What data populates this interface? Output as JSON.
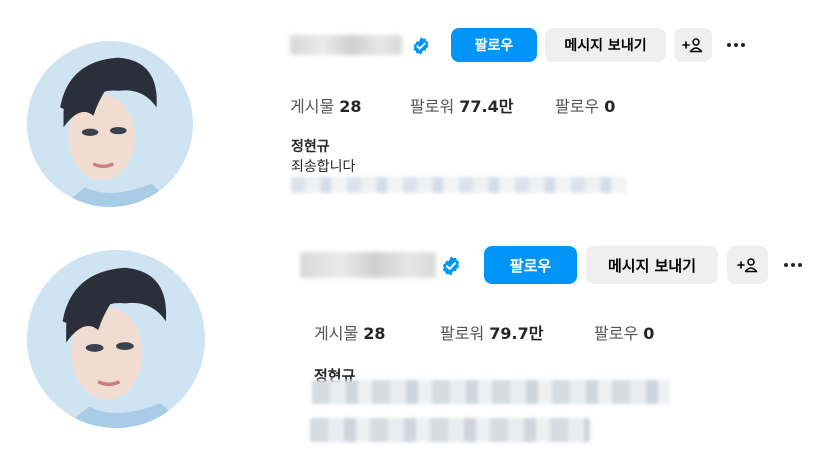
{
  "profiles": [
    {
      "buttons": {
        "follow": "팔로우",
        "message": "메시지 보내기"
      },
      "stats": {
        "posts_label": "게시물",
        "posts": "28",
        "followers_label": "팔로워",
        "followers": "77.4만",
        "following_label": "팔로우",
        "following": "0"
      },
      "name": "정현규",
      "bio": "죄송합니다"
    },
    {
      "buttons": {
        "follow": "팔로우",
        "message": "메시지 보내기"
      },
      "stats": {
        "posts_label": "게시물",
        "posts": "28",
        "followers_label": "팔로워",
        "followers": "79.7만",
        "following_label": "팔로우",
        "following": "0"
      },
      "name": "정현규"
    }
  ],
  "icons": {
    "verified": "verified-badge-icon",
    "add_person": "add-person-icon",
    "more": "more-options-icon"
  },
  "colors": {
    "follow_button": "#0095f6",
    "secondary_button": "#efefef",
    "verified_badge": "#0095f6"
  }
}
